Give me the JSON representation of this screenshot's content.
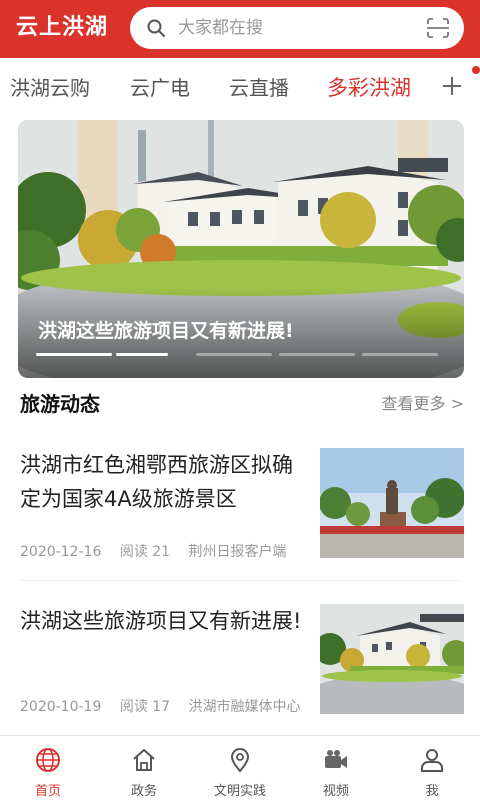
{
  "header": {
    "logo": "云上洪湖",
    "search_placeholder": "大家都在搜",
    "brand_color": "#d9332b"
  },
  "tabs": [
    {
      "label": "洪湖云购",
      "active": false
    },
    {
      "label": "云广电",
      "active": false
    },
    {
      "label": "云直播",
      "active": false
    },
    {
      "label": "多彩洪湖",
      "active": true
    }
  ],
  "tabs_plus_icon": "plus-icon",
  "banner": {
    "caption": "洪湖这些旅游项目又有新进展!",
    "slide_count": 5,
    "active_slide": 1
  },
  "section": {
    "title": "旅游动态",
    "more": "查看更多 >"
  },
  "articles": [
    {
      "title": "洪湖市红色湘鄂西旅游区拟确定为国家4A级旅游景区",
      "date": "2020-12-16",
      "reads": "阅读 21",
      "source": "荆州日报客户端",
      "thumb": "memorial-statue-photo"
    },
    {
      "title": "洪湖这些旅游项目又有新进展!",
      "date": "2020-10-19",
      "reads": "阅读 17",
      "source": "洪湖市融媒体中心",
      "thumb": "villa-model-photo"
    }
  ],
  "bottom_nav": [
    {
      "label": "首页",
      "icon": "globe-icon",
      "active": true
    },
    {
      "label": "政务",
      "icon": "home-icon",
      "active": false
    },
    {
      "label": "文明实践",
      "icon": "location-pin-icon",
      "active": false
    },
    {
      "label": "视频",
      "icon": "video-camera-icon",
      "active": false
    },
    {
      "label": "我",
      "icon": "user-icon",
      "active": false
    }
  ]
}
